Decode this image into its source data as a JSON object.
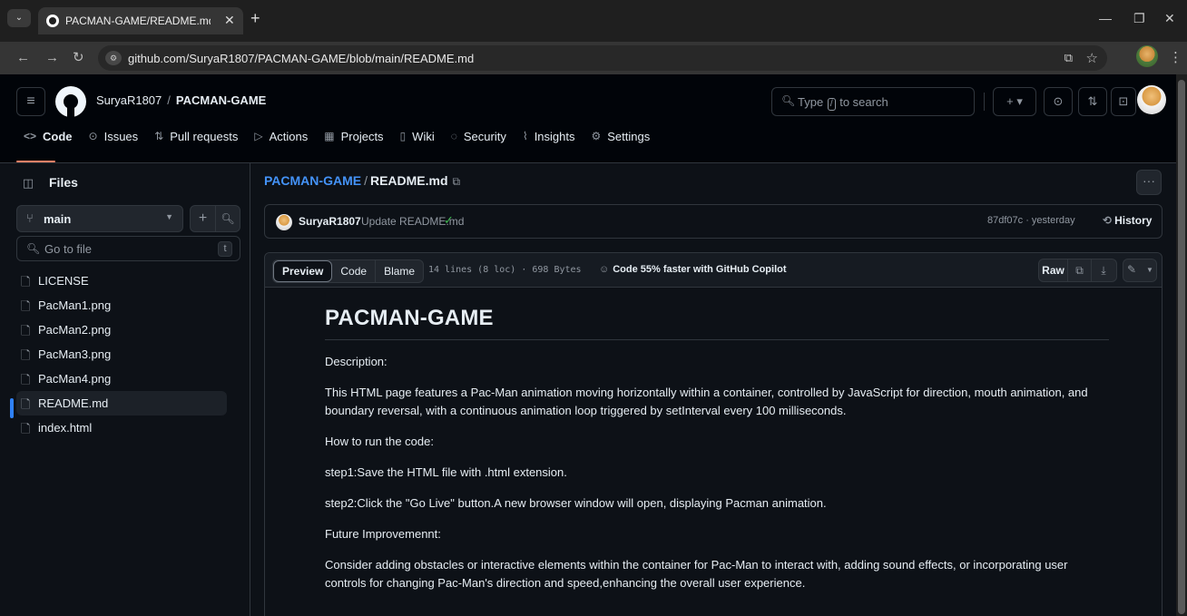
{
  "browser": {
    "tab_title": "PACMAN-GAME/README.md a",
    "url": "github.com/SuryaR1807/PACMAN-GAME/blob/main/README.md"
  },
  "header": {
    "owner": "SuryaR1807",
    "separator": "/",
    "repo": "PACMAN-GAME",
    "search_prefix": "Type",
    "search_key": "/",
    "search_suffix": "to search"
  },
  "repo_nav": {
    "tabs": [
      {
        "label": "Code",
        "icon": "<>"
      },
      {
        "label": "Issues",
        "icon": "⊙"
      },
      {
        "label": "Pull requests",
        "icon": "⇅"
      },
      {
        "label": "Actions",
        "icon": "▷"
      },
      {
        "label": "Projects",
        "icon": "▦"
      },
      {
        "label": "Wiki",
        "icon": "▯"
      },
      {
        "label": "Security",
        "icon": "◌"
      },
      {
        "label": "Insights",
        "icon": "⌇"
      },
      {
        "label": "Settings",
        "icon": "⚙"
      }
    ]
  },
  "sidebar": {
    "title": "Files",
    "branch": "main",
    "search_placeholder": "Go to file",
    "search_shortcut": "t",
    "files": [
      "LICENSE",
      "PacMan1.png",
      "PacMan2.png",
      "PacMan3.png",
      "PacMan4.png",
      "README.md",
      "index.html"
    ],
    "active_file": "README.md"
  },
  "file": {
    "crumb_repo": "PACMAN-GAME",
    "crumb_sep": "/",
    "crumb_file": "README.md",
    "commit_author": "SuryaR1807",
    "commit_message": "Update README.md",
    "commit_meta": "87df07c · yesterday",
    "history_label": "History",
    "view_preview": "Preview",
    "view_code": "Code",
    "view_blame": "Blame",
    "stats": "14 lines (8 loc) · 698 Bytes",
    "copilot_promo": "Code 55% faster with GitHub Copilot",
    "raw_label": "Raw"
  },
  "readme": {
    "title": "PACMAN-GAME",
    "paragraphs": [
      "Description:",
      "This HTML page features a Pac-Man animation moving horizontally within a container, controlled by JavaScript for direction, mouth animation, and boundary reversal, with a continuous animation loop triggered by setInterval every 100 milliseconds.",
      "How to run the code:",
      "step1:Save the HTML file with .html extension.",
      "step2:Click the \"Go Live\" button.A new browser window will open, displaying Pacman animation.",
      "Future Improvemennt:",
      "Consider adding obstacles or interactive elements within the container for Pac-Man to interact with, adding sound effects, or incorporating user controls for changing Pac-Man's direction and speed,enhancing the overall user experience."
    ]
  },
  "colors": {
    "bg": "#0d1117",
    "header_bg": "#010409",
    "accent": "#4493f8",
    "tab_underline": "#f78166",
    "success": "#3fb950"
  }
}
